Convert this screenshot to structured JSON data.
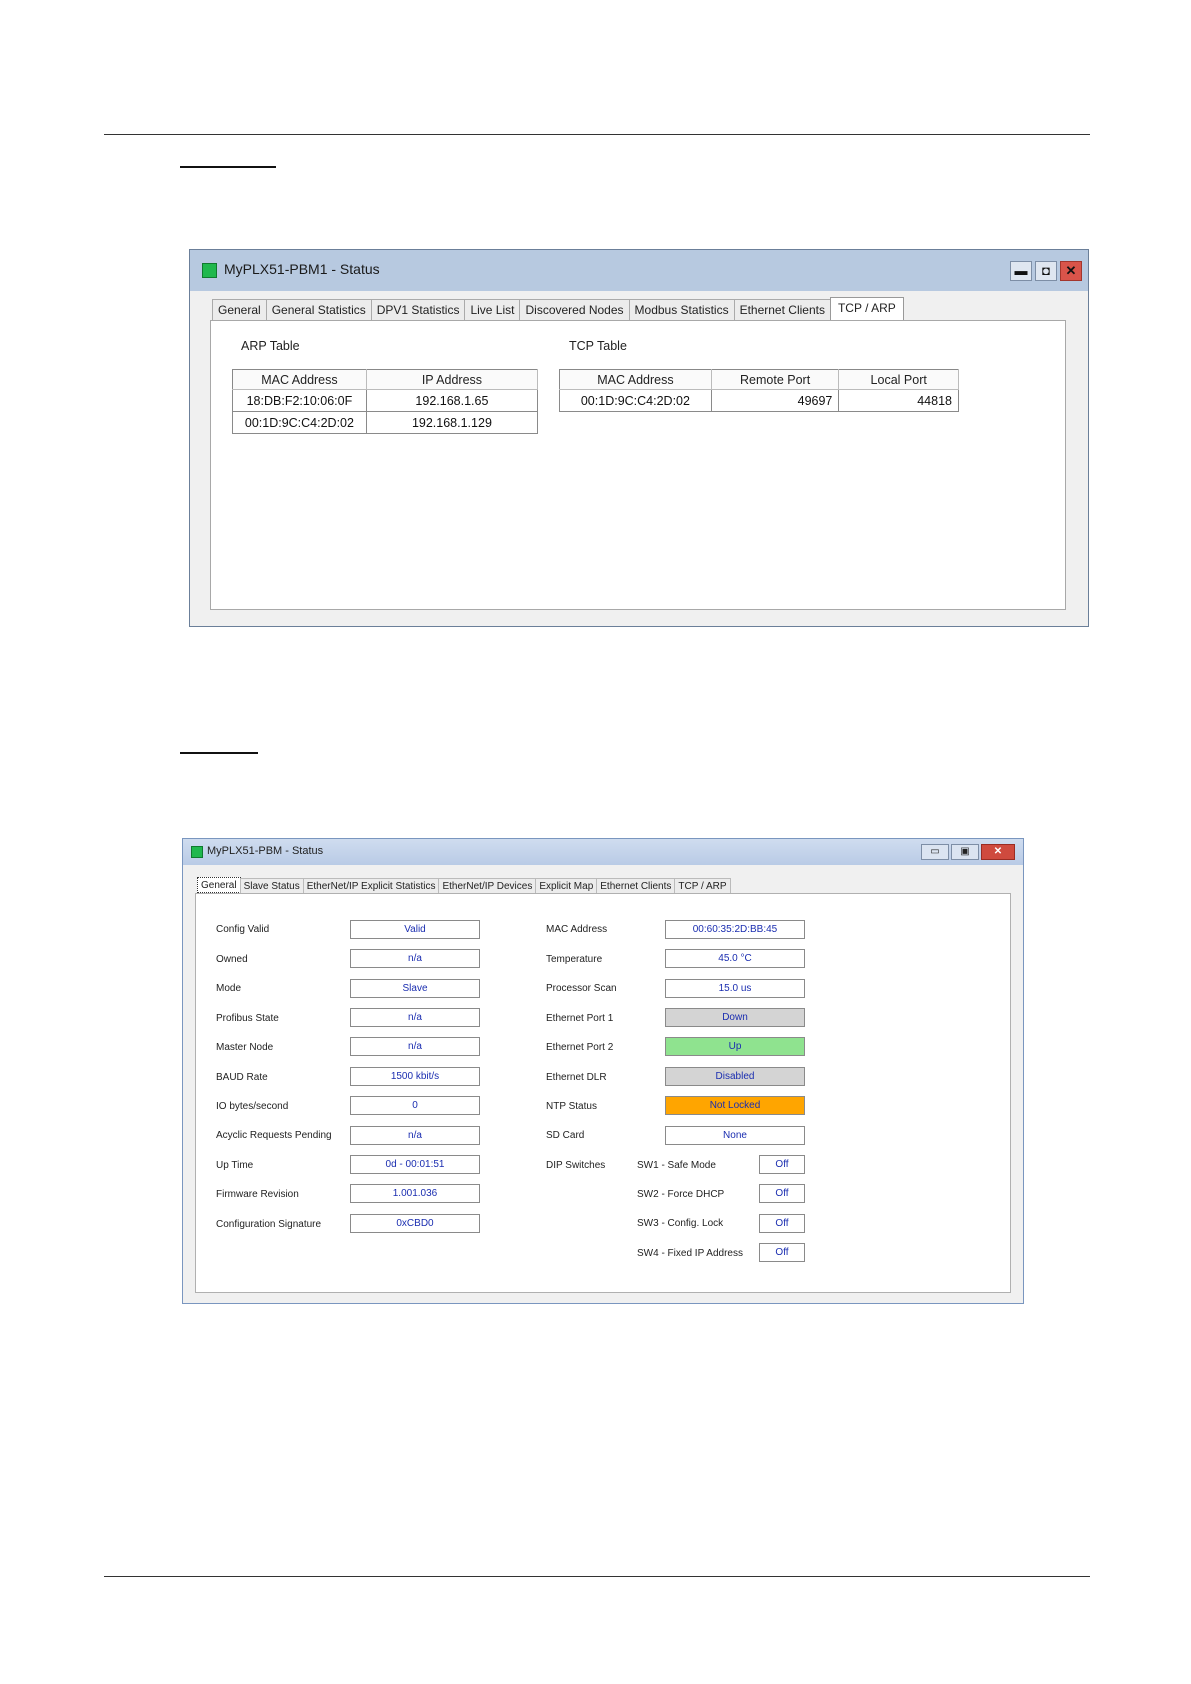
{
  "window1": {
    "title": "MyPLX51-PBM1 - Status",
    "controls": {
      "minimize": "▬",
      "maximize": "◘",
      "close": "✕"
    },
    "tabs": [
      "General",
      "General Statistics",
      "DPV1 Statistics",
      "Live List",
      "Discovered Nodes",
      "Modbus Statistics",
      "Ethernet Clients",
      "TCP / ARP"
    ],
    "active_tab": "TCP / ARP",
    "arp_table": {
      "label": "ARP Table",
      "headers": [
        "MAC Address",
        "IP Address"
      ],
      "rows": [
        [
          "18:DB:F2:10:06:0F",
          "192.168.1.65"
        ],
        [
          "00:1D:9C:C4:2D:02",
          "192.168.1.129"
        ]
      ]
    },
    "tcp_table": {
      "label": "TCP Table",
      "headers": [
        "MAC Address",
        "Remote Port",
        "Local Port"
      ],
      "rows": [
        [
          "00:1D:9C:C4:2D:02",
          "49697",
          "44818"
        ]
      ]
    }
  },
  "window2": {
    "title": "MyPLX51-PBM - Status",
    "controls": {
      "minimize": "▭",
      "maximize": "▣",
      "close": "✕"
    },
    "tabs": [
      "General",
      "Slave Status",
      "EtherNet/IP Explicit Statistics",
      "EtherNet/IP Devices",
      "Explicit Map",
      "Ethernet Clients",
      "TCP / ARP"
    ],
    "active_tab": "General",
    "left_fields": [
      {
        "label": "Config Valid",
        "value": "Valid"
      },
      {
        "label": "Owned",
        "value": "n/a"
      },
      {
        "label": "Mode",
        "value": "Slave"
      },
      {
        "label": "Profibus State",
        "value": "n/a"
      },
      {
        "label": "Master Node",
        "value": "n/a"
      },
      {
        "label": "BAUD Rate",
        "value": "1500 kbit/s"
      },
      {
        "label": "IO bytes/second",
        "value": "0"
      },
      {
        "label": "Acyclic Requests Pending",
        "value": "n/a"
      },
      {
        "label": "Up Time",
        "value": "0d - 00:01:51"
      },
      {
        "label": "Firmware Revision",
        "value": "1.001.036"
      },
      {
        "label": "Configuration Signature",
        "value": "0xCBD0"
      }
    ],
    "right_fields": [
      {
        "label": "MAC Address",
        "value": "00:60:35:2D:BB:45",
        "status": "normal"
      },
      {
        "label": "Temperature",
        "value": "45.0 °C",
        "status": "normal"
      },
      {
        "label": "Processor Scan",
        "value": "15.0 us",
        "status": "normal"
      },
      {
        "label": "Ethernet Port 1",
        "value": "Down",
        "status": "gray"
      },
      {
        "label": "Ethernet Port 2",
        "value": "Up",
        "status": "green"
      },
      {
        "label": "Ethernet DLR",
        "value": "Disabled",
        "status": "gray"
      },
      {
        "label": "NTP Status",
        "value": "Not Locked",
        "status": "orange"
      },
      {
        "label": "SD Card",
        "value": "None",
        "status": "normal"
      }
    ],
    "dip_switches": {
      "label": "DIP Switches",
      "items": [
        {
          "label": "SW1 - Safe Mode",
          "value": "Off"
        },
        {
          "label": "SW2 - Force DHCP",
          "value": "Off"
        },
        {
          "label": "SW3 - Config. Lock",
          "value": "Off"
        },
        {
          "label": "SW4 - Fixed IP Address",
          "value": "Off"
        }
      ]
    },
    "status_colors": {
      "gray": "#d4d4d4",
      "green": "#8fe38f",
      "orange": "#ffa500",
      "value_text": "#1a2db0"
    }
  }
}
